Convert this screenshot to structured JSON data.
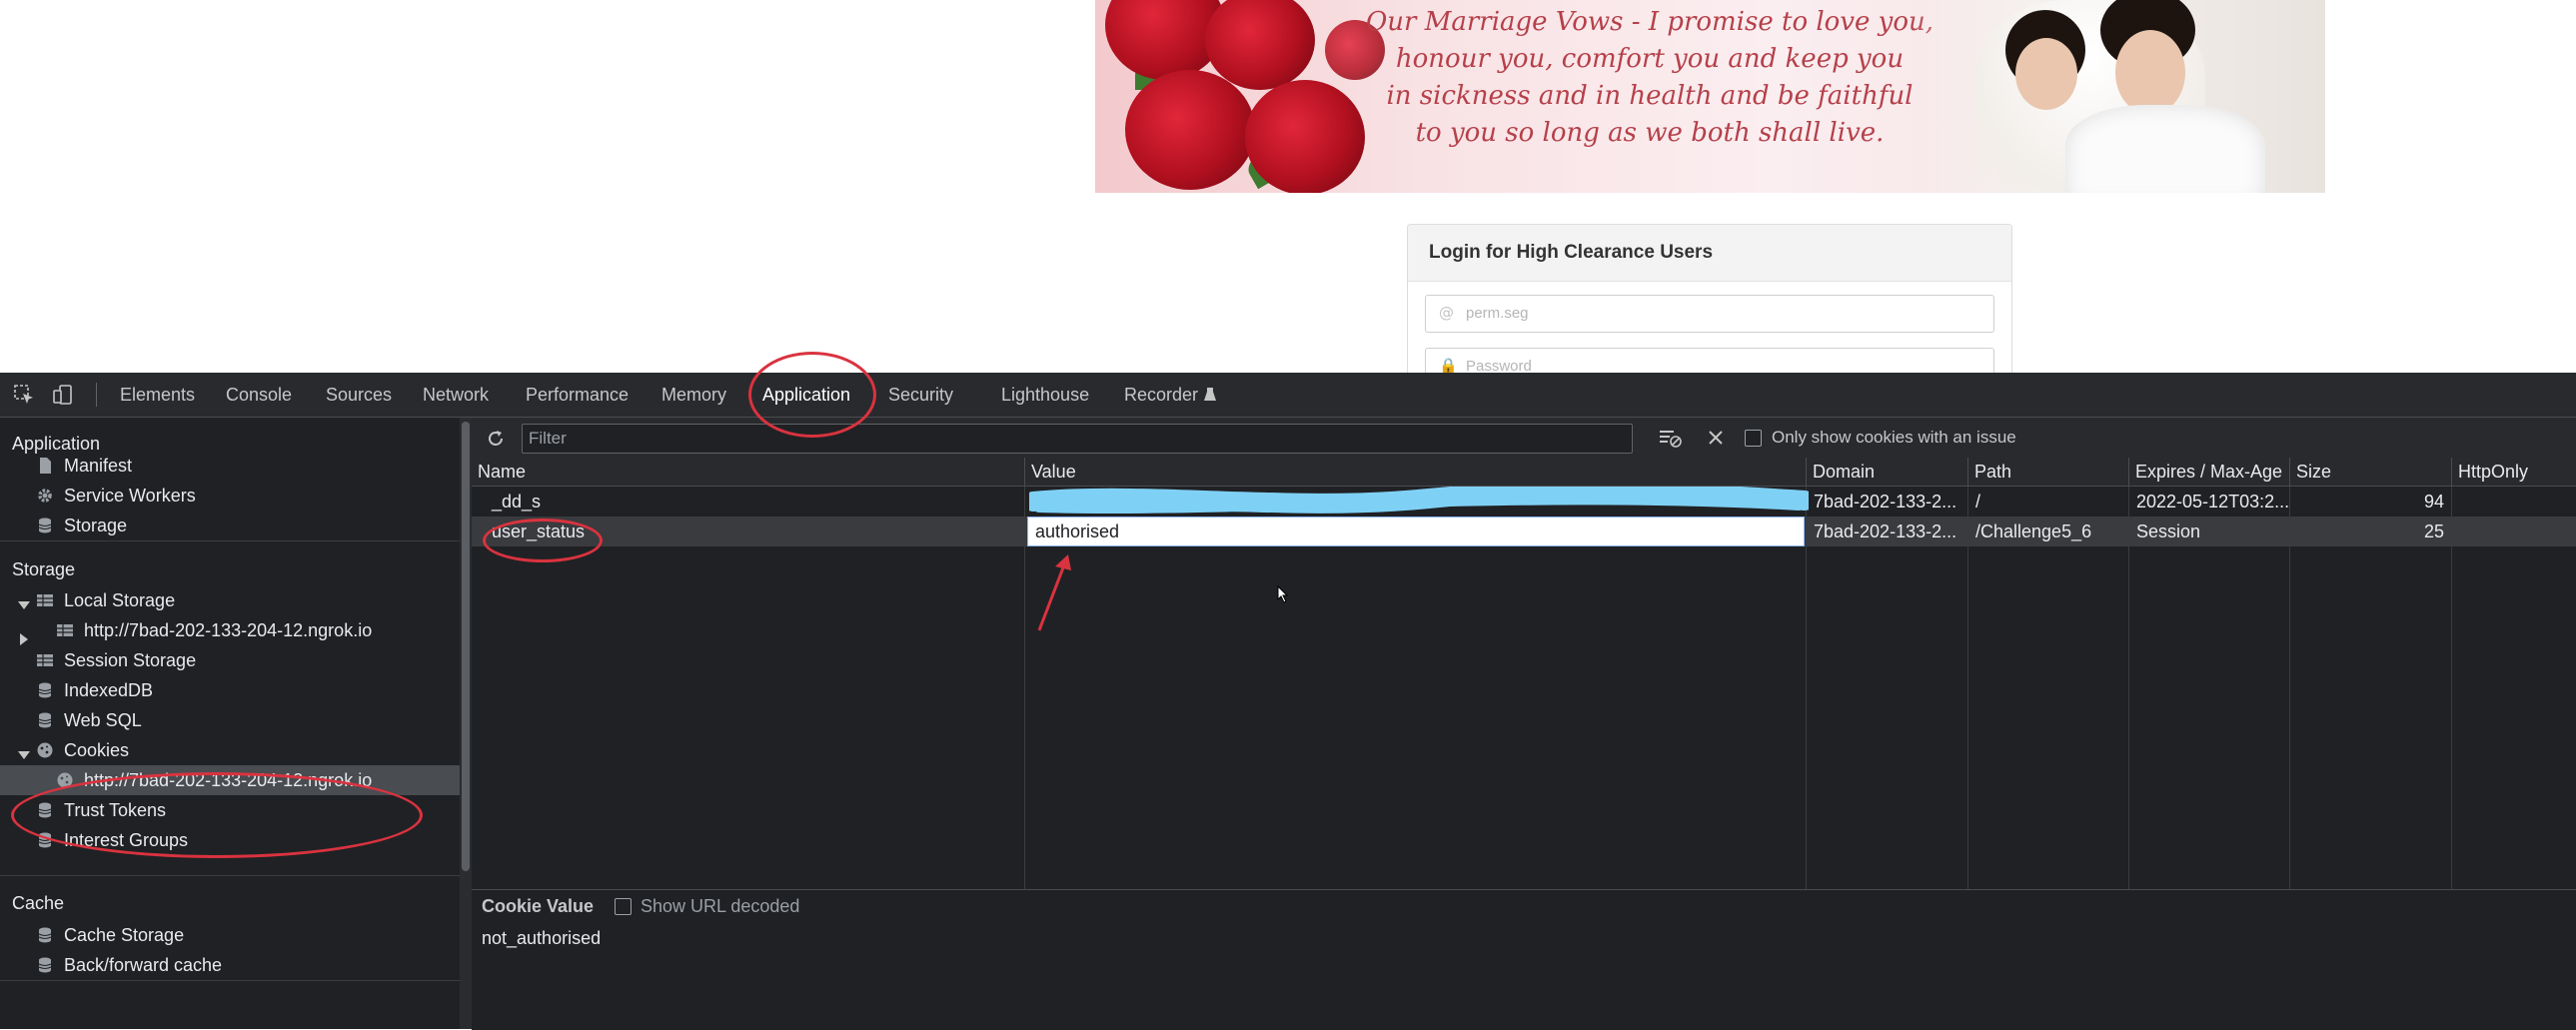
{
  "page": {
    "banner": {
      "vow_lines": [
        "Our Marriage Vows - I promise to love you,",
        "honour you, comfort you and keep you",
        "in sickness and in health and be faithful",
        "to you so long as we both shall live."
      ]
    },
    "login": {
      "title": "Login for High Clearance Users",
      "username_placeholder": "perm.seg",
      "password_placeholder": "Password"
    }
  },
  "devtools": {
    "tabs": [
      "Elements",
      "Console",
      "Sources",
      "Network",
      "Performance",
      "Memory",
      "Application",
      "Security",
      "Lighthouse",
      "Recorder"
    ],
    "active_tab": "Application",
    "sidebar": {
      "application_header": "Application",
      "application_items": [
        "Manifest",
        "Service Workers",
        "Storage"
      ],
      "storage_header": "Storage",
      "storage_items": {
        "local_storage": "Local Storage",
        "local_storage_origin": "http://7bad-202-133-204-12.ngrok.io",
        "session_storage": "Session Storage",
        "indexeddb": "IndexedDB",
        "websql": "Web SQL",
        "cookies": "Cookies",
        "cookies_origin": "http://7bad-202-133-204-12.ngrok.io",
        "trust_tokens": "Trust Tokens",
        "interest_groups": "Interest Groups"
      },
      "cache_header": "Cache",
      "cache_items": [
        "Cache Storage",
        "Back/forward cache"
      ]
    },
    "cookies": {
      "filter_placeholder": "Filter",
      "only_issue_label": "Only show cookies with an issue",
      "columns": [
        "Name",
        "Value",
        "Domain",
        "Path",
        "Expires / Max-Age",
        "Size",
        "HttpOnly"
      ],
      "rows": [
        {
          "name": "_dd_s",
          "value": "",
          "domain": "7bad-202-133-2...",
          "path": "/",
          "expires": "2022-05-12T03:2...",
          "size": "94"
        },
        {
          "name": "user_status",
          "value": "authorised",
          "domain": "7bad-202-133-2...",
          "path": "/Challenge5_6",
          "expires": "Session",
          "size": "25"
        }
      ],
      "detail_label": "Cookie Value",
      "show_url_decoded": "Show URL decoded",
      "detail_value": "not_authorised"
    }
  },
  "colors": {
    "annotation": "#d9333f",
    "redaction": "#7fd0f5"
  }
}
